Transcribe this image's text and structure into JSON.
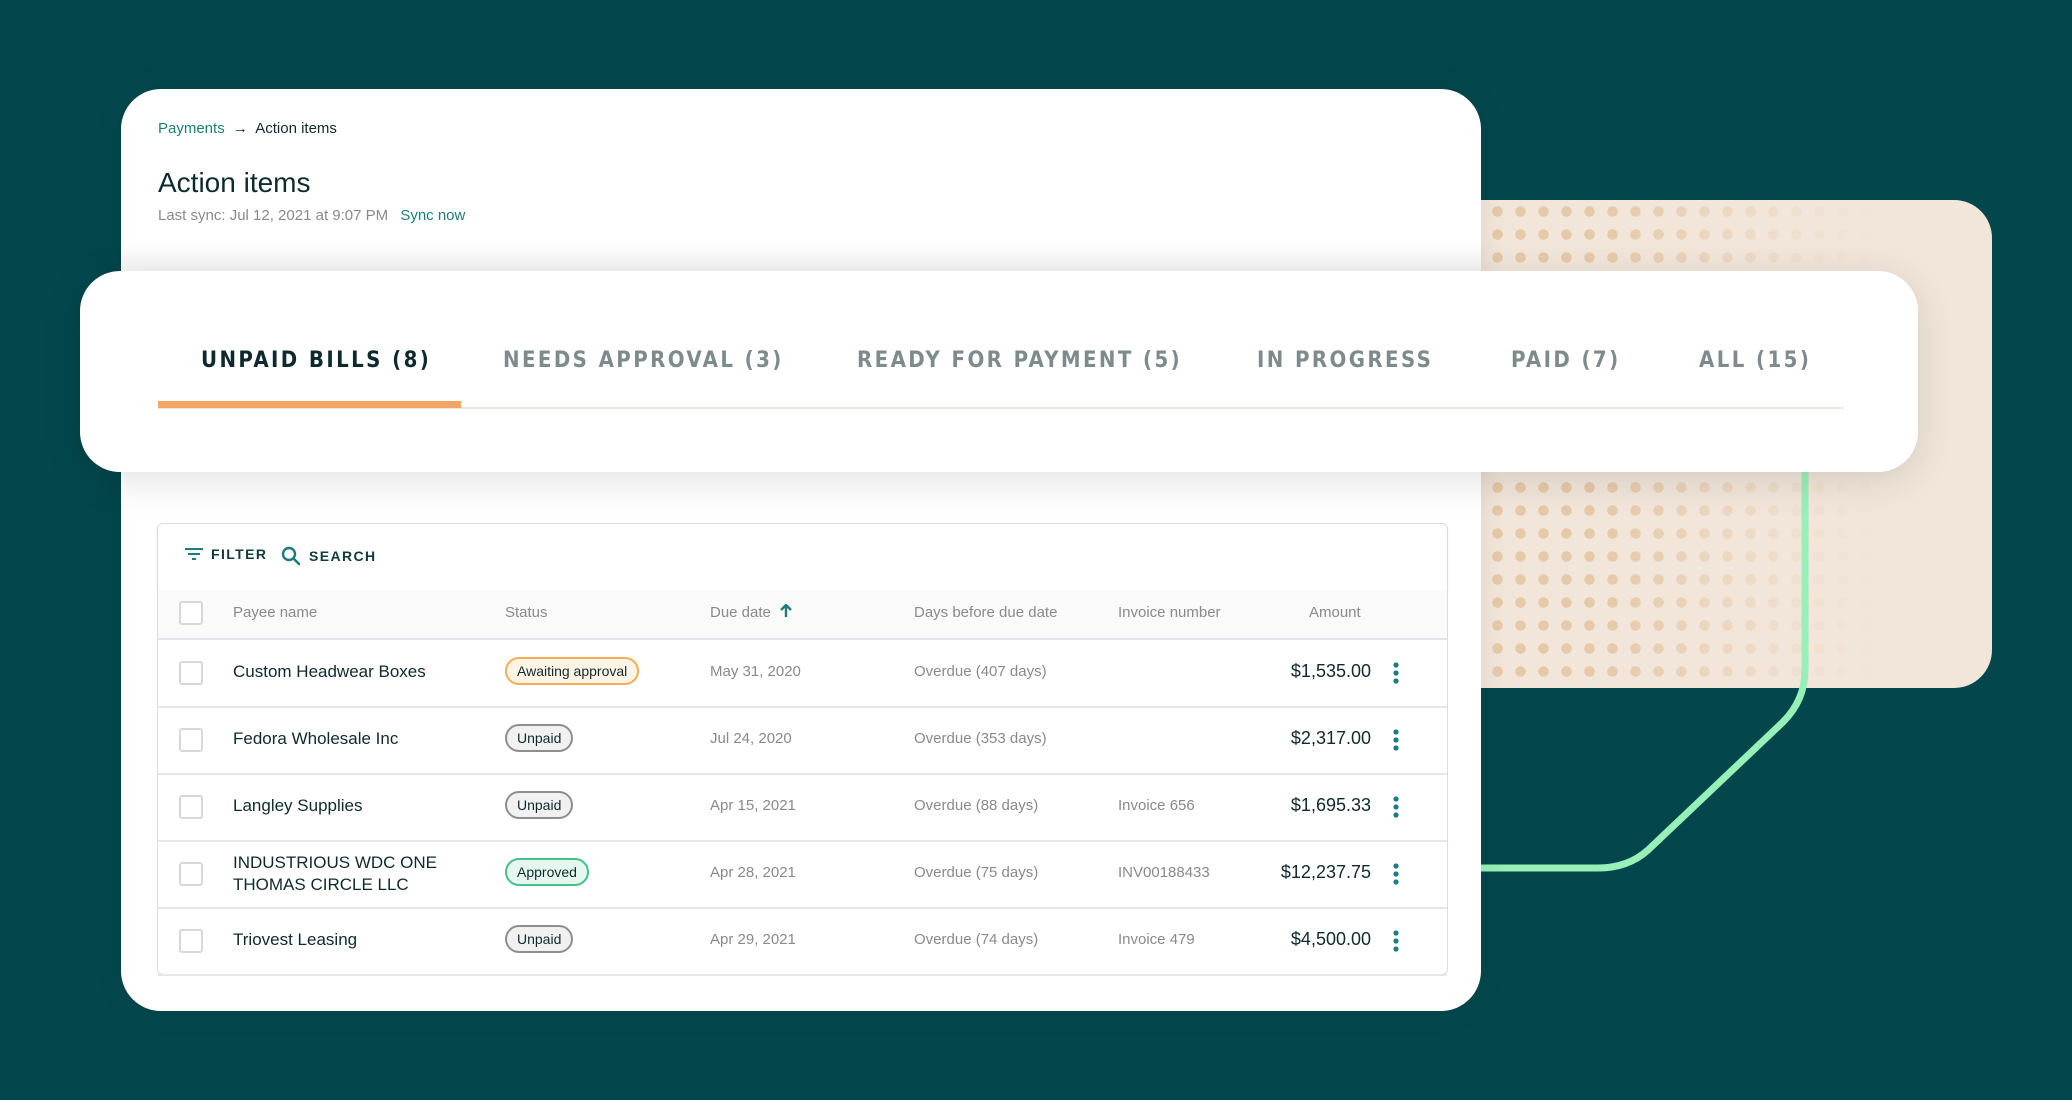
{
  "colors": {
    "background": "#03474C",
    "accent_teal": "#1E7C7E",
    "tab_underline": "#F4A565",
    "decor_green_line": "#97F0B8",
    "decor_beige": "#F2E6DA"
  },
  "breadcrumb": {
    "parent": "Payments",
    "separator_icon": "arrow-right-icon",
    "separator": "→",
    "current": "Action items"
  },
  "header": {
    "title": "Action items",
    "last_sync": "Last sync: Jul 12, 2021 at 9:07 PM",
    "sync_now": "Sync now"
  },
  "tabs": [
    {
      "label": "UNPAID BILLS (8)",
      "active": true
    },
    {
      "label": "NEEDS APPROVAL (3)",
      "active": false
    },
    {
      "label": "READY FOR PAYMENT (5)",
      "active": false
    },
    {
      "label": "IN PROGRESS",
      "active": false
    },
    {
      "label": "PAID (7)",
      "active": false
    },
    {
      "label": "ALL (15)",
      "active": false
    }
  ],
  "toolbar": {
    "filter_label": "FILTER",
    "filter_icon": "filter-icon",
    "search_label": "SEARCH",
    "search_icon": "search-icon"
  },
  "table": {
    "columns": [
      "Payee name",
      "Status",
      "Due date",
      "Days before due date",
      "Invoice number",
      "Amount"
    ],
    "sort": {
      "column": "Due date",
      "direction": "ascending",
      "icon": "arrow-up-icon"
    },
    "rows": [
      {
        "payee": "Custom Headwear Boxes",
        "status": "Awaiting approval",
        "status_type": "awaiting",
        "due_date": "May 31, 2020",
        "days": "Overdue (407 days)",
        "invoice": "",
        "amount": "$1,535.00"
      },
      {
        "payee": "Fedora Wholesale Inc",
        "status": "Unpaid",
        "status_type": "unpaid",
        "due_date": "Jul 24, 2020",
        "days": "Overdue (353 days)",
        "invoice": "",
        "amount": "$2,317.00"
      },
      {
        "payee": "Langley Supplies",
        "status": "Unpaid",
        "status_type": "unpaid",
        "due_date": "Apr 15, 2021",
        "days": "Overdue (88 days)",
        "invoice": "Invoice 656",
        "amount": "$1,695.33"
      },
      {
        "payee": "INDUSTRIOUS WDC ONE THOMAS CIRCLE LLC",
        "status": "Approved",
        "status_type": "approved",
        "due_date": "Apr 28, 2021",
        "days": "Overdue (75 days)",
        "invoice": "INV00188433",
        "amount": "$12,237.75"
      },
      {
        "payee": "Triovest Leasing",
        "status": "Unpaid",
        "status_type": "unpaid",
        "due_date": "Apr 29, 2021",
        "days": "Overdue (74 days)",
        "invoice": "Invoice 479",
        "amount": "$4,500.00"
      }
    ]
  }
}
